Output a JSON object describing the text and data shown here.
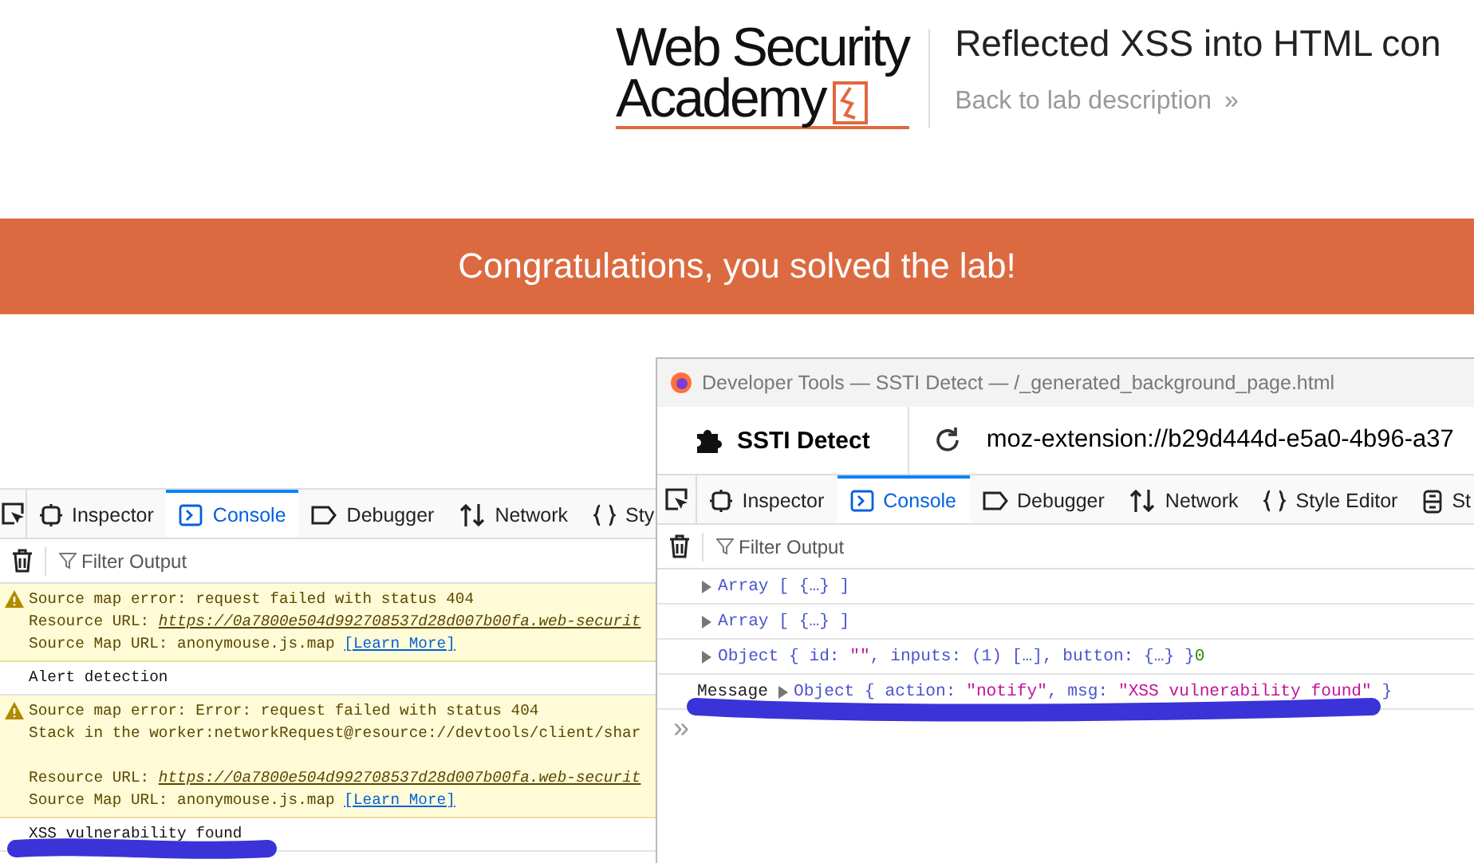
{
  "header": {
    "logo_line1": "Web Security",
    "logo_line2": "Academy",
    "title": "Reflected XSS into HTML con",
    "back_link": "Back to lab description",
    "back_icon": "»"
  },
  "banner": {
    "text": "Congratulations, you solved the lab!"
  },
  "devtools": {
    "tabs": [
      {
        "label": "Inspector",
        "selected": false
      },
      {
        "label": "Console",
        "selected": true
      },
      {
        "label": "Debugger",
        "selected": false
      },
      {
        "label": "Network",
        "selected": false
      },
      {
        "label": "Sty",
        "selected": false
      }
    ],
    "filter": {
      "placeholder": "Filter Output"
    },
    "messages": [
      {
        "kind": "warning",
        "lines": [
          {
            "text": "Source map error: request failed with status 404"
          },
          {
            "text": "Resource URL: ",
            "url": "https://0a7800e504d992708537d28d007b00fa.web-securit"
          },
          {
            "text": "Source Map URL: anonymouse.js.map ",
            "link": "[Learn More]"
          }
        ]
      },
      {
        "kind": "log",
        "lines": [
          {
            "text": "Alert detection"
          }
        ]
      },
      {
        "kind": "warning",
        "lines": [
          {
            "text": "Source map error: Error: request failed with status 404"
          },
          {
            "text": "Stack in the worker:networkRequest@resource://devtools/client/shar"
          },
          {
            "kind": "blank"
          },
          {
            "text": "Resource URL: ",
            "url": "https://0a7800e504d992708537d28d007b00fa.web-securit"
          },
          {
            "text": "Source Map URL: anonymouse.js.map ",
            "link": "[Learn More]"
          }
        ]
      },
      {
        "kind": "log",
        "lines": [
          {
            "text": "XSS vulnerability found"
          }
        ]
      }
    ]
  },
  "window": {
    "title": "Developer Tools — SSTI Detect — /_generated_background_page.html",
    "extension": "SSTI Detect",
    "url": "moz-extension://b29d444d-e5a0-4b96-a37",
    "tabs": [
      {
        "label": "Inspector",
        "selected": false
      },
      {
        "label": "Console",
        "selected": true
      },
      {
        "label": "Debugger",
        "selected": false
      },
      {
        "label": "Network",
        "selected": false
      },
      {
        "label": "Style Editor",
        "selected": false
      },
      {
        "label": "St",
        "selected": false
      }
    ],
    "filter": {
      "placeholder": "Filter Output"
    },
    "messages": [
      {
        "tokens": [
          {
            "kind": "obj",
            "text": "Array [ {…} ]"
          }
        ]
      },
      {
        "tokens": [
          {
            "kind": "obj",
            "text": "Array [ {…} ]"
          }
        ]
      },
      {
        "tokens": [
          {
            "kind": "obj",
            "text": "Object { id: "
          },
          {
            "kind": "string",
            "text": "\"\""
          },
          {
            "kind": "obj",
            "text": ", inputs: (1) […], button: {…} }"
          },
          {
            "kind": "number",
            "text": "0"
          }
        ]
      },
      {
        "prefix": "Message",
        "tokens": [
          {
            "kind": "obj",
            "text": "Object { action: "
          },
          {
            "kind": "string",
            "text": "\"notify\""
          },
          {
            "kind": "obj",
            "text": ", msg: "
          },
          {
            "kind": "string",
            "text": "\"XSS vulnerability found\""
          },
          {
            "kind": "obj",
            "text": " }"
          }
        ]
      }
    ],
    "prompt": "»"
  }
}
